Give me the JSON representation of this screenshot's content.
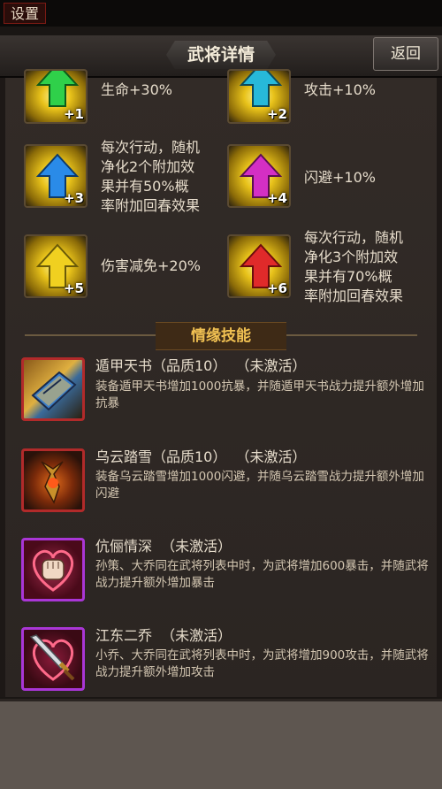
{
  "topbar": {
    "settings_label": "设置"
  },
  "header": {
    "title": "武将详情",
    "back_label": "返回"
  },
  "stars": [
    {
      "level": "+1",
      "bonus": "生命+30%",
      "color": "#2fd04a"
    },
    {
      "level": "+2",
      "bonus": "攻击+10%",
      "color": "#27b9d9"
    },
    {
      "level": "+3",
      "bonus": "每次行动，随机净化2个附加效果并有50%概率附加回春效果",
      "bonus_lines": [
        "每次行动，随机",
        "净化2个附加效",
        "果并有50%概",
        "率附加回春效果"
      ],
      "color": "#2a8be8"
    },
    {
      "level": "+4",
      "bonus": "闪避+10%",
      "color": "#d42fc4"
    },
    {
      "level": "+5",
      "bonus": "伤害减免+20%",
      "color": "#f0d020"
    },
    {
      "level": "+6",
      "bonus": "每次行动，随机净化3个附加效果并有70%概率附加回春效果",
      "bonus_lines": [
        "每次行动，随机",
        "净化3个附加效",
        "果并有70%概",
        "率附加回春效果"
      ],
      "color": "#e02a2a"
    }
  ],
  "section_title": "情缘技能",
  "skills": [
    {
      "name": "遁甲天书（品质10）  （未激活）",
      "desc": "装备遁甲天书增加1000抗暴，并随遁甲天书战力提升额外增加抗暴",
      "icon": "book-icon"
    },
    {
      "name": "乌云踏雪（品质10）  （未激活）",
      "desc": "装备乌云踏雪增加1000闪避，并随乌云踏雪战力提升额外增加闪避",
      "icon": "warhorse-icon"
    },
    {
      "name": "伉俪情深  （未激活）",
      "desc": "孙策、大乔同在武将列表中时，为武将增加600暴击，并随武将战力提升额外增加暴击",
      "icon": "fist-heart-icon"
    },
    {
      "name": "江东二乔  （未激活）",
      "desc": "小乔、大乔同在武将列表中时，为武将增加900攻击，并随武将战力提升额外增加攻击",
      "icon": "sword-heart-icon"
    }
  ]
}
